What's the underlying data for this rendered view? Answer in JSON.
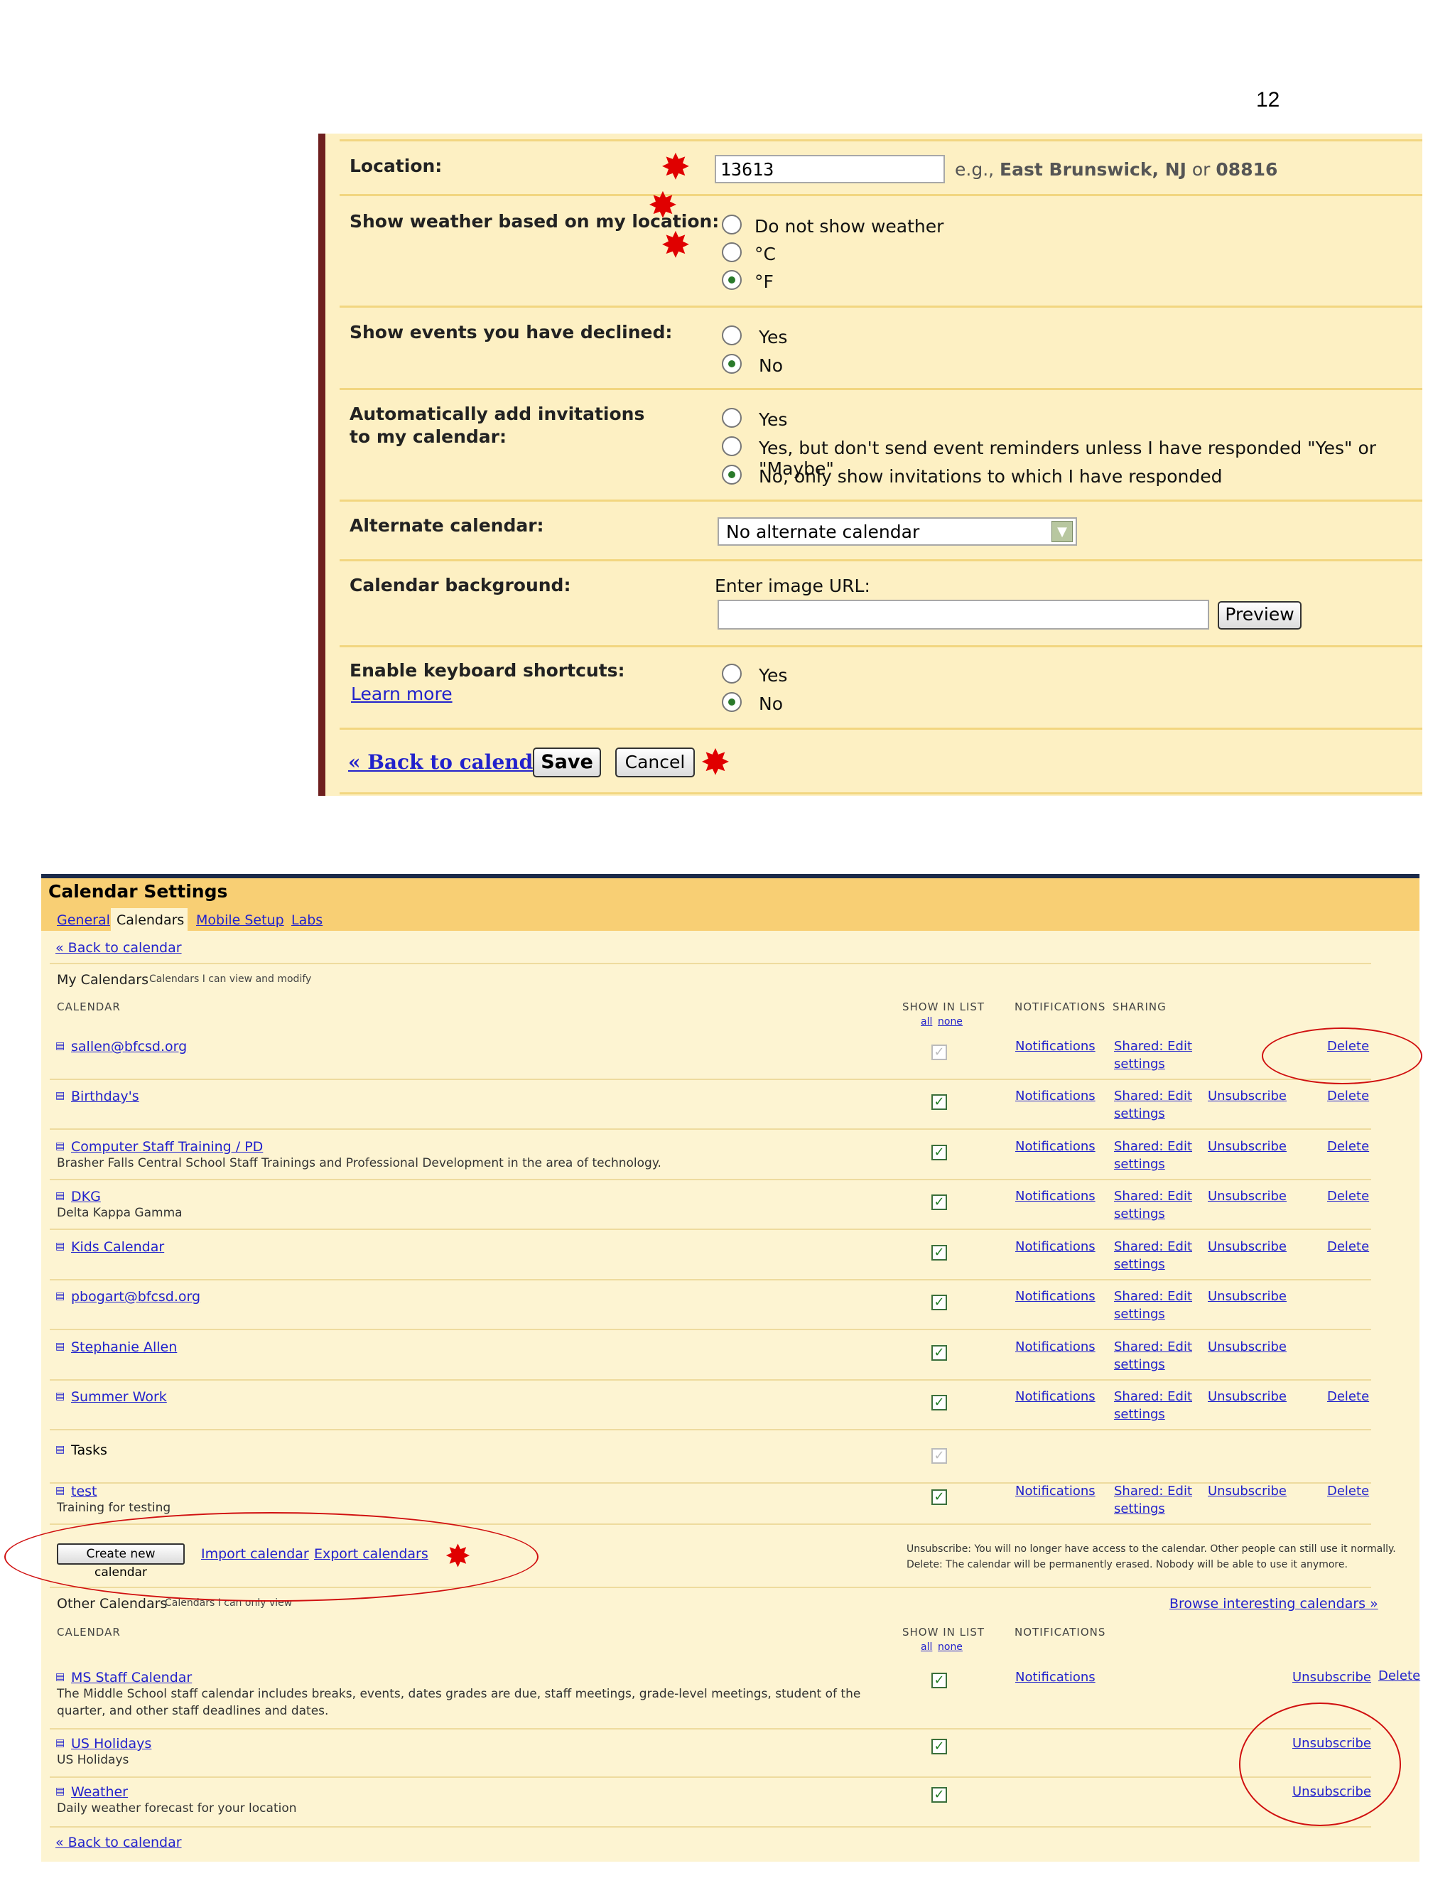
{
  "page_number": "12",
  "general": {
    "location": {
      "label": "Location:",
      "value": "13613",
      "hint_prefix": "e.g., ",
      "hint_example": "East Brunswick, NJ",
      "hint_or": " or ",
      "hint_zip": "08816"
    },
    "weather": {
      "label": "Show weather based on my location:",
      "options": [
        "Do not show weather",
        "°C",
        "°F"
      ],
      "selected": 2
    },
    "declined": {
      "label": "Show events you have declined:",
      "options": [
        "Yes",
        "No"
      ],
      "selected": 1
    },
    "invitations": {
      "label": "Automatically add invitations to my calendar:",
      "options": [
        "Yes",
        "Yes, but don't send event reminders unless I have responded \"Yes\" or \"Maybe\"",
        "No, only show invitations to which I have responded"
      ],
      "selected": 2
    },
    "alternate": {
      "label": "Alternate calendar:",
      "value": "No alternate calendar"
    },
    "background": {
      "label": "Calendar background:",
      "sub_label": "Enter image URL:",
      "value": "",
      "preview_button": "Preview"
    },
    "shortcuts": {
      "label": "Enable keyboard shortcuts:",
      "learn_more": "Learn more",
      "options": [
        "Yes",
        "No"
      ],
      "selected": 1
    },
    "footer": {
      "back_link": "« Back to calendar",
      "save_button": "Save",
      "cancel_button": "Cancel"
    }
  },
  "calendar_settings": {
    "title": "Calendar Settings",
    "tabs": [
      {
        "label": "General",
        "active": false
      },
      {
        "label": "Calendars",
        "active": true
      },
      {
        "label": "Mobile Setup",
        "active": false
      },
      {
        "label": "Labs",
        "active": false
      }
    ],
    "back_link": "« Back to calendar",
    "my_calendars": {
      "title": "My Calendars",
      "subtitle": "Calendars I can view and modify",
      "col_calendar": "CALENDAR",
      "col_show": "SHOW IN LIST",
      "col_show_all": "all",
      "col_show_none": "none",
      "col_notifications": "NOTIFICATIONS",
      "col_sharing": "SHARING",
      "rows": [
        {
          "name": "sallen@bfcsd.org",
          "desc": "",
          "checked": true,
          "disabled": true,
          "notifications": "Notifications",
          "sharing1": "Shared: Edit",
          "sharing2": "settings",
          "unsubscribe": "",
          "delete": "Delete"
        },
        {
          "name": "Birthday's",
          "desc": "",
          "checked": true,
          "disabled": false,
          "notifications": "Notifications",
          "sharing1": "Shared: Edit",
          "sharing2": "settings",
          "unsubscribe": "Unsubscribe",
          "delete": "Delete"
        },
        {
          "name": "Computer Staff Training / PD",
          "desc": "Brasher Falls Central School Staff Trainings and Professional Development in the area of technology.",
          "checked": true,
          "disabled": false,
          "notifications": "Notifications",
          "sharing1": "Shared: Edit",
          "sharing2": "settings",
          "unsubscribe": "Unsubscribe",
          "delete": "Delete"
        },
        {
          "name": "DKG",
          "desc": "Delta Kappa Gamma",
          "checked": true,
          "disabled": false,
          "notifications": "Notifications",
          "sharing1": "Shared: Edit",
          "sharing2": "settings",
          "unsubscribe": "Unsubscribe",
          "delete": "Delete"
        },
        {
          "name": "Kids Calendar",
          "desc": "",
          "checked": true,
          "disabled": false,
          "notifications": "Notifications",
          "sharing1": "Shared: Edit",
          "sharing2": "settings",
          "unsubscribe": "Unsubscribe",
          "delete": "Delete"
        },
        {
          "name": "pbogart@bfcsd.org",
          "desc": "",
          "checked": true,
          "disabled": false,
          "notifications": "Notifications",
          "sharing1": "Shared: Edit",
          "sharing2": "settings",
          "unsubscribe": "Unsubscribe",
          "delete": ""
        },
        {
          "name": "Stephanie Allen",
          "desc": "",
          "checked": true,
          "disabled": false,
          "notifications": "Notifications",
          "sharing1": "Shared: Edit",
          "sharing2": "settings",
          "unsubscribe": "Unsubscribe",
          "delete": ""
        },
        {
          "name": "Summer Work",
          "desc": "",
          "checked": true,
          "disabled": false,
          "notifications": "Notifications",
          "sharing1": "Shared: Edit",
          "sharing2": "settings",
          "unsubscribe": "Unsubscribe",
          "delete": "Delete"
        },
        {
          "name": "Tasks",
          "desc": "",
          "checked": true,
          "disabled": true,
          "notifications": "",
          "sharing1": "",
          "sharing2": "",
          "unsubscribe": "",
          "delete": ""
        },
        {
          "name": "test",
          "desc": "Training for testing",
          "checked": true,
          "disabled": false,
          "notifications": "Notifications",
          "sharing1": "Shared: Edit",
          "sharing2": "settings",
          "unsubscribe": "Unsubscribe",
          "delete": "Delete"
        }
      ],
      "create_button": "Create new calendar",
      "import_link": "Import calendar",
      "export_link": "Export calendars",
      "note_unsubscribe": "Unsubscribe: You will no longer have access to the calendar. Other people can still use it normally.",
      "note_delete": "Delete: The calendar will be permanently erased. Nobody will be able to use it anymore."
    },
    "other_calendars": {
      "title": "Other Calendars",
      "subtitle": "Calendars I can only view",
      "browse_link": "Browse interesting calendars »",
      "col_calendar": "CALENDAR",
      "col_show": "SHOW IN LIST",
      "col_show_all": "all",
      "col_show_none": "none",
      "col_notifications": "NOTIFICATIONS",
      "rows": [
        {
          "name": "MS Staff Calendar",
          "desc1": "The Middle School staff calendar includes breaks, events, dates grades are due, staff meetings, grade-level meetings, student of the",
          "desc2": "quarter, and other staff deadlines and dates.",
          "checked": true,
          "notifications": "Notifications",
          "unsubscribe": "Unsubscribe",
          "delete": "Delete"
        },
        {
          "name": "US Holidays",
          "desc1": "US Holidays",
          "desc2": "",
          "checked": true,
          "notifications": "",
          "unsubscribe": "Unsubscribe",
          "delete": ""
        },
        {
          "name": "Weather",
          "desc1": "Daily weather forecast for your location",
          "desc2": "",
          "checked": true,
          "notifications": "",
          "unsubscribe": "Unsubscribe",
          "delete": ""
        }
      ]
    },
    "bottom_back_link": "« Back to calendar"
  },
  "colors": {
    "panel_bg": "#fdf0c3",
    "header_bg": "#f8cf74",
    "link": "#2222cc",
    "annotation": "#e00000",
    "left_bar": "#6e1f1f"
  }
}
